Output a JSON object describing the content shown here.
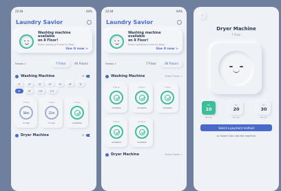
{
  "status": {
    "time": "22:04",
    "battery": "64%"
  },
  "app": {
    "title": "Laundry Savior"
  },
  "banner": {
    "line1": "Washing machine available",
    "line2": "on 8 Floor!",
    "sub": "Rudra Upadhyay 8 used by Alban",
    "cta": "Use it now >"
  },
  "floors": {
    "label": "Female 1",
    "tabs": [
      "7 Floor",
      "All Floors"
    ]
  },
  "washing": {
    "title": "Washing Machine",
    "right": "8F"
  },
  "chips": [
    "1F",
    "2F",
    "3F",
    "4F",
    "5F",
    "6F",
    "7F",
    "8F",
    "9F",
    "10F",
    "11F"
  ],
  "screen1_machines": [
    {
      "floor": "7 Floor",
      "value": "58m",
      "status": "In Use"
    },
    {
      "floor": "7 Floor",
      "value": "22m",
      "status": "In Use"
    },
    {
      "floor": "7 Floor",
      "value": "",
      "status": "Available"
    }
  ],
  "screen2": {
    "washing_right": "Select Floors +",
    "machines": [
      {
        "floor": "8 Floor",
        "status": "Available"
      },
      {
        "floor": "8 Floor",
        "status": "Available"
      },
      {
        "floor": "7 Floor",
        "status": "Available"
      },
      {
        "floor": "8 Floor",
        "status": "Available"
      },
      {
        "floor": "12 Floor",
        "status": "Available"
      }
    ]
  },
  "dryer": {
    "title": "Dryer Machine",
    "right1": "8F",
    "right2": "Select Floors +"
  },
  "detail": {
    "title": "Dryer Machine",
    "floor": "7 Floor",
    "prices": [
      {
        "label": "MY",
        "value": "10",
        "sub": "45 min"
      },
      {
        "label": "MY",
        "value": "20",
        "sub": "60 min"
      },
      {
        "label": "MY",
        "value": "30",
        "sub": "90 min"
      }
    ],
    "pay": "Select a payment method",
    "coins": "or Insert Coin into the machine"
  }
}
